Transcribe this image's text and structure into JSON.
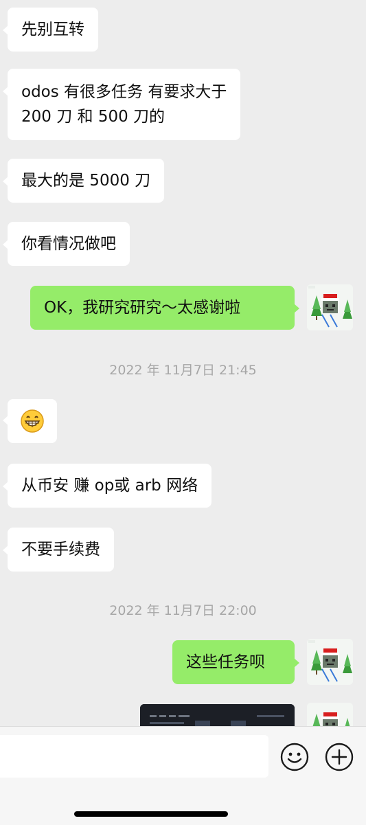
{
  "messages": [
    {
      "side": "in",
      "text": "先别互转"
    },
    {
      "side": "in",
      "line1": "odos 有很多任务  有要求大于",
      "line2": "200 刀 和 500 刀的"
    },
    {
      "side": "in",
      "text": "最大的是 5000 刀"
    },
    {
      "side": "in",
      "text": "你看情况做吧"
    },
    {
      "side": "out",
      "text": "OK，我研究研究～太感谢啦"
    },
    {
      "side": "time",
      "text": "2022 年 11月7日 21:45"
    },
    {
      "side": "in",
      "emoji": "grinning-face"
    },
    {
      "side": "in",
      "text": "从币安 赚 op或 arb 网络"
    },
    {
      "side": "in",
      "text": "不要手续费"
    },
    {
      "side": "time",
      "text": "2022 年 11月7日 22:00"
    },
    {
      "side": "out",
      "text": "这些任务呗"
    },
    {
      "side": "out",
      "image": "screenshot-thumbnail"
    }
  ],
  "input_bar": {
    "placeholder": "",
    "icons": [
      "emoji-icon",
      "plus-icon"
    ]
  },
  "colors": {
    "background": "#ededed",
    "incoming_bubble": "#ffffff",
    "outgoing_bubble": "#95ec69",
    "timestamp": "#a6a6a6"
  }
}
